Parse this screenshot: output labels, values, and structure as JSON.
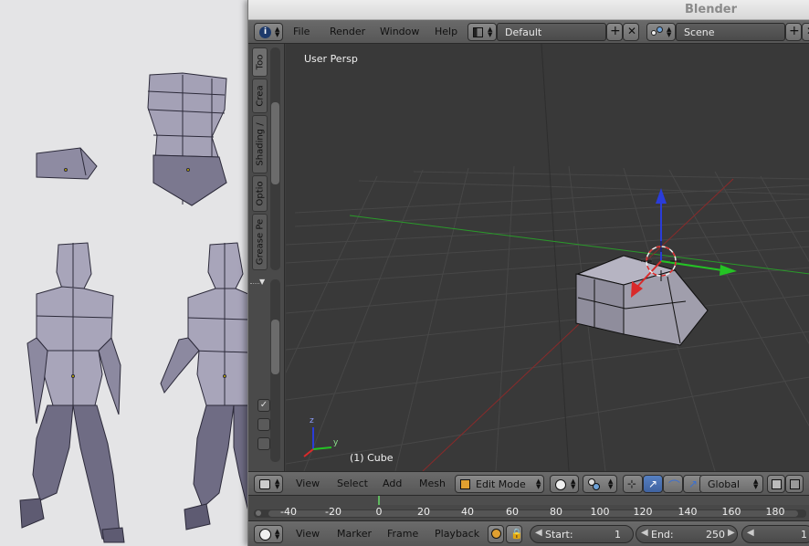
{
  "window": {
    "title": "Blender"
  },
  "menu": {
    "file": "File",
    "render": "Render",
    "window": "Window",
    "help": "Help",
    "screen_layout": "Default",
    "scene": "Scene"
  },
  "toolshelf": {
    "tabs": [
      "Too",
      "Crea",
      "Shading /",
      "Optio",
      "Grease Pe"
    ]
  },
  "viewport": {
    "view_name": "User Persp",
    "object_label": "(1) Cube",
    "axis_x": "y",
    "axis_z": "z"
  },
  "view3d_header": {
    "view": "View",
    "select": "Select",
    "add": "Add",
    "mesh": "Mesh",
    "mode": "Edit Mode",
    "orientation": "Global"
  },
  "timeline": {
    "ticks": [
      "-40",
      "-20",
      "0",
      "20",
      "40",
      "60",
      "80",
      "100",
      "120",
      "140",
      "160",
      "180"
    ],
    "current_frame": 1
  },
  "timeline_header": {
    "view": "View",
    "marker": "Marker",
    "frame": "Frame",
    "playback": "Playback",
    "start_label": "Start:",
    "start_value": "1",
    "end_label": "End:",
    "end_value": "250",
    "current": "1"
  },
  "colors": {
    "x_axis": "#d92a2a",
    "y_axis": "#24c324",
    "z_axis": "#2a3cd9",
    "mesh": "#a3a1b1"
  }
}
